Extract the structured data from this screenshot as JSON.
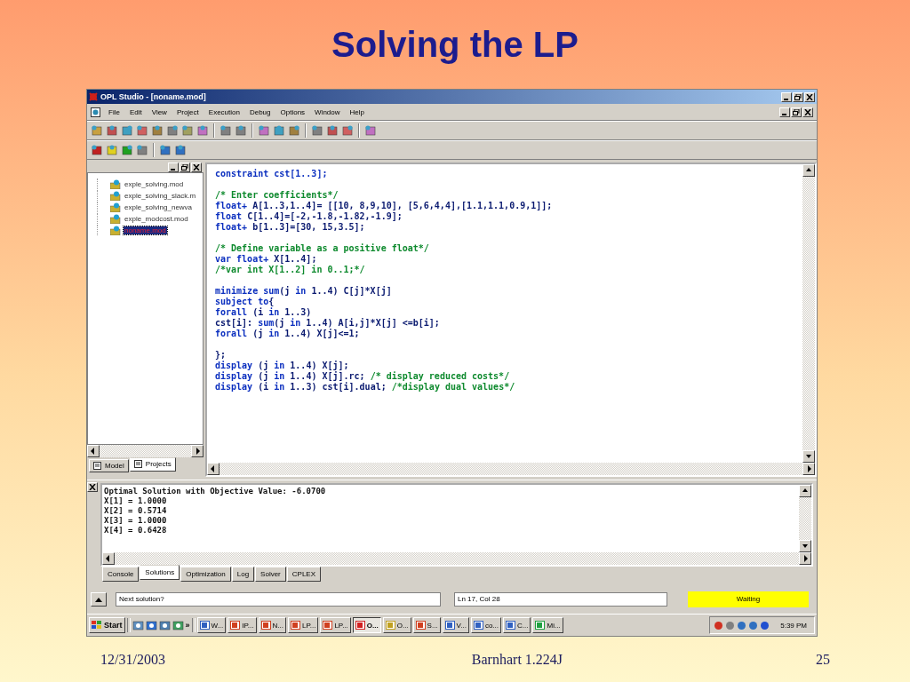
{
  "slide": {
    "title": "Solving the LP",
    "footer": {
      "date": "12/31/2003",
      "center": "Barnhart 1.224J",
      "page": "25"
    }
  },
  "window": {
    "title": "OPL Studio - [noname.mod]",
    "menu": [
      "File",
      "Edit",
      "View",
      "Project",
      "Execution",
      "Debug",
      "Options",
      "Window",
      "Help"
    ],
    "project_tree": [
      {
        "label": "exple_solving.mod",
        "selected": false
      },
      {
        "label": "exple_solving_slack.m",
        "selected": false
      },
      {
        "label": "exple_solving_newva",
        "selected": false
      },
      {
        "label": "exple_modcost.mod",
        "selected": false
      },
      {
        "label": "noname.mod",
        "selected": true
      }
    ],
    "left_tabs": [
      {
        "label": "Model",
        "selected": false
      },
      {
        "label": "Projects",
        "selected": true
      }
    ],
    "editor": {
      "blocks": [
        [
          [
            {
              "text": "constraint cst[1..3];",
              "kind": "keyword"
            }
          ]
        ],
        [
          [
            {
              "text": "/* Enter coefficients*/",
              "kind": "comment"
            }
          ],
          [
            {
              "text": "float+",
              "kind": "keyword"
            },
            {
              "text": " A[1..3,1..4]= [[10, 8,9,10], [5,6,4,4],[1.1,1.1,0.9,1]];",
              "kind": "plain"
            }
          ],
          [
            {
              "text": "float",
              "kind": "keyword"
            },
            {
              "text": " C[1..4]=[-2,-1.8,-1.82,-1.9];",
              "kind": "plain"
            }
          ],
          [
            {
              "text": "float+",
              "kind": "keyword"
            },
            {
              "text": " b[1..3]=[30, 15,3.5];",
              "kind": "plain"
            }
          ]
        ],
        [
          [
            {
              "text": "/* Define variable as a positive float*/",
              "kind": "comment"
            }
          ],
          [
            {
              "text": "var float+",
              "kind": "keyword"
            },
            {
              "text": " X[1..4];",
              "kind": "plain"
            }
          ],
          [
            {
              "text": "/*var int X[1..2] in 0..1;*/",
              "kind": "comment"
            }
          ]
        ],
        [
          [
            {
              "text": "minimize sum",
              "kind": "keyword"
            },
            {
              "text": "(j ",
              "kind": "plain"
            },
            {
              "text": "in",
              "kind": "keyword"
            },
            {
              "text": " 1..4) C[j]*X[j]",
              "kind": "plain"
            }
          ],
          [
            {
              "text": "subject to",
              "kind": "keyword"
            },
            {
              "text": "{",
              "kind": "plain"
            }
          ],
          [
            {
              "text": "forall",
              "kind": "keyword"
            },
            {
              "text": " (i ",
              "kind": "plain"
            },
            {
              "text": "in",
              "kind": "keyword"
            },
            {
              "text": " 1..3)",
              "kind": "plain"
            }
          ],
          [
            {
              "text": "cst[i]: ",
              "kind": "plain"
            },
            {
              "text": "sum",
              "kind": "keyword"
            },
            {
              "text": "(j ",
              "kind": "plain"
            },
            {
              "text": "in",
              "kind": "keyword"
            },
            {
              "text": " 1..4) A[i,j]*X[j] <=b[i];",
              "kind": "plain"
            }
          ],
          [
            {
              "text": "forall",
              "kind": "keyword"
            },
            {
              "text": " (j ",
              "kind": "plain"
            },
            {
              "text": "in",
              "kind": "keyword"
            },
            {
              "text": " 1..4) X[j]<=1;",
              "kind": "plain"
            }
          ]
        ],
        [
          [
            {
              "text": "};",
              "kind": "plain"
            }
          ],
          [
            {
              "text": "display",
              "kind": "keyword"
            },
            {
              "text": " (j ",
              "kind": "plain"
            },
            {
              "text": "in",
              "kind": "keyword"
            },
            {
              "text": " 1..4) X[j];",
              "kind": "plain"
            }
          ],
          [
            {
              "text": "display",
              "kind": "keyword"
            },
            {
              "text": " (j ",
              "kind": "plain"
            },
            {
              "text": "in",
              "kind": "keyword"
            },
            {
              "text": " 1..4) X[j].rc; ",
              "kind": "plain"
            },
            {
              "text": "/* display reduced costs*/",
              "kind": "comment"
            }
          ],
          [
            {
              "text": "display",
              "kind": "keyword"
            },
            {
              "text": " (i ",
              "kind": "plain"
            },
            {
              "text": "in",
              "kind": "keyword"
            },
            {
              "text": " 1..3) cst[i].dual; ",
              "kind": "plain"
            },
            {
              "text": "/*display dual values*/",
              "kind": "comment"
            }
          ]
        ]
      ]
    },
    "output": {
      "lines": [
        "Optimal Solution with Objective Value: -6.0700",
        "X[1] = 1.0000",
        "X[2] = 0.5714",
        "X[3] = 1.0000",
        "X[4] = 0.6428"
      ]
    },
    "output_tabs": [
      {
        "label": "Console",
        "selected": false
      },
      {
        "label": "Solutions",
        "selected": true
      },
      {
        "label": "Optimization",
        "selected": false
      },
      {
        "label": "Log",
        "selected": false
      },
      {
        "label": "Solver",
        "selected": false
      },
      {
        "label": "CPLEX",
        "selected": false
      }
    ],
    "status": {
      "prompt": "Next solution?",
      "position": "Ln 17, Col 28",
      "state": "Waiting"
    }
  },
  "taskbar": {
    "start": "Start",
    "overflow": "»",
    "buttons": [
      {
        "label": "W...",
        "selected": false
      },
      {
        "label": "IP...",
        "selected": false
      },
      {
        "label": "N...",
        "selected": false
      },
      {
        "label": "LP...",
        "selected": false
      },
      {
        "label": "LP...",
        "selected": false
      },
      {
        "label": "O...",
        "selected": true
      },
      {
        "label": "O...",
        "selected": false
      },
      {
        "label": "S...",
        "selected": false
      },
      {
        "label": "V...",
        "selected": false
      },
      {
        "label": "co...",
        "selected": false
      },
      {
        "label": "C...",
        "selected": false
      },
      {
        "label": "Mi...",
        "selected": false
      }
    ],
    "clock": "5:39 PM"
  }
}
